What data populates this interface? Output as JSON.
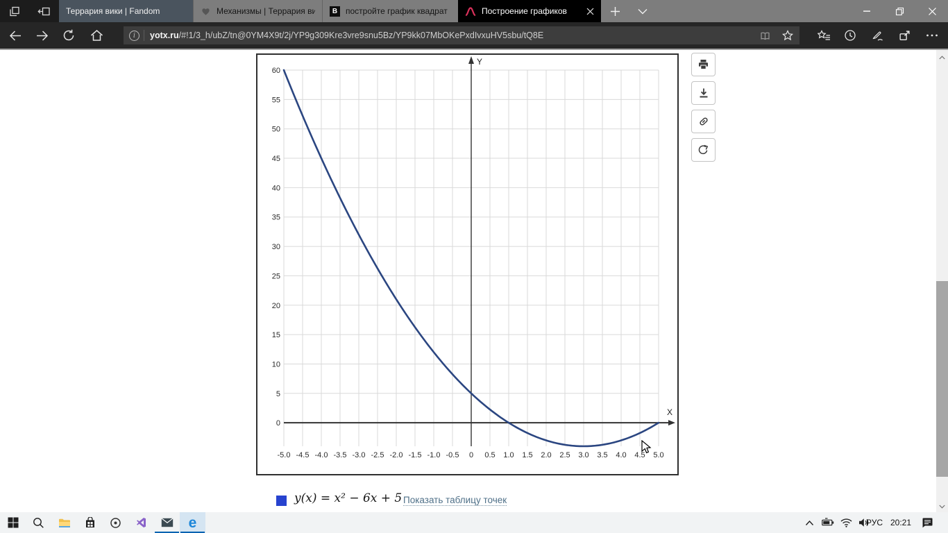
{
  "tabstrip": {
    "tabs": [
      {
        "title": "Террария вики | Fandom"
      },
      {
        "title": "Механизмы | Террария вик"
      },
      {
        "title": "постройте график квадрат",
        "favicon_letter": "В"
      },
      {
        "title": "Построение графиков"
      }
    ]
  },
  "navbar": {
    "url_domain": "yotx.ru",
    "url_path": "/#!1/3_h/ubZ/tn@0YM4X9t/2j/YP9g309Kre3vre9snu5Bz/YP9kk07MbOKePxdIvxuHV5sbu/tQ8E"
  },
  "chart_data": {
    "type": "line",
    "title": "",
    "function": "y(x) = x^2 - 6x + 5",
    "coefficients": {
      "a": 1,
      "b": -6,
      "c": 5
    },
    "x_range": [
      -5,
      5
    ],
    "y_grid_range": [
      -4,
      60
    ],
    "x_tick_step": 0.5,
    "y_tick_step": 5,
    "x_tick_labels": [
      "-5.0",
      "-4.5",
      "-4.0",
      "-3.5",
      "-3.0",
      "-2.5",
      "-2.0",
      "-1.5",
      "-1.0",
      "-0.5",
      "0",
      "0.5",
      "1.0",
      "1.5",
      "2.0",
      "2.5",
      "3.0",
      "3.5",
      "4.0",
      "4.5",
      "5.0"
    ],
    "y_tick_labels": [
      "0",
      "5",
      "10",
      "15",
      "20",
      "25",
      "30",
      "35",
      "40",
      "45",
      "50",
      "55",
      "60"
    ],
    "x_axis_label": "X",
    "y_axis_label": "Y",
    "grid": true,
    "grid_color": "#d9d9d9",
    "axis_color": "#333333",
    "series": [
      {
        "name": "y(x) = x² − 6x + 5",
        "color": "#2b4681",
        "points": [
          [
            -5,
            60
          ],
          [
            -4.5,
            52.25
          ],
          [
            -4,
            45
          ],
          [
            -3.5,
            38.25
          ],
          [
            -3,
            32
          ],
          [
            -2.5,
            26.25
          ],
          [
            -2,
            21
          ],
          [
            -1.5,
            16.25
          ],
          [
            -1,
            12
          ],
          [
            -0.5,
            8.25
          ],
          [
            0,
            5
          ],
          [
            0.5,
            2.25
          ],
          [
            1,
            0
          ],
          [
            1.5,
            -1.75
          ],
          [
            2,
            -3
          ],
          [
            2.5,
            -3.75
          ],
          [
            3,
            -4
          ],
          [
            3.5,
            -3.75
          ],
          [
            4,
            -3
          ],
          [
            4.5,
            -1.75
          ],
          [
            5,
            0
          ]
        ]
      }
    ]
  },
  "legend": {
    "swatch_color": "#2743cf",
    "formula": "y(x) = x² − 6x + 5",
    "table_link": "Показать таблицу точек"
  },
  "tray": {
    "language": "РУС",
    "time": "20:21"
  }
}
